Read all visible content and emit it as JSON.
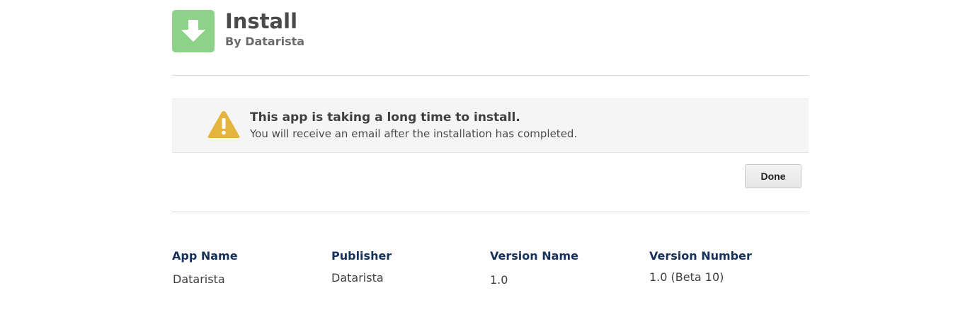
{
  "header": {
    "title": "Install",
    "subtitle": "By Datarista",
    "icon": "download-arrow-icon"
  },
  "alert": {
    "icon": "warning-icon",
    "title": "This app is taking a long time to install.",
    "message": "You will receive an email after the installation has completed."
  },
  "actions": {
    "done_label": "Done"
  },
  "details": {
    "columns": [
      {
        "label": "App Name",
        "value": "Datarista"
      },
      {
        "label": "Publisher",
        "value": "Datarista"
      },
      {
        "label": "Version Name",
        "value": "1.0"
      },
      {
        "label": "Version Number",
        "value": "1.0 (Beta 10)"
      }
    ]
  },
  "colors": {
    "icon_green": "#8ed28a",
    "warning_yellow": "#e5b43c",
    "heading_navy": "#16325c",
    "alert_bg": "#f5f5f5"
  }
}
